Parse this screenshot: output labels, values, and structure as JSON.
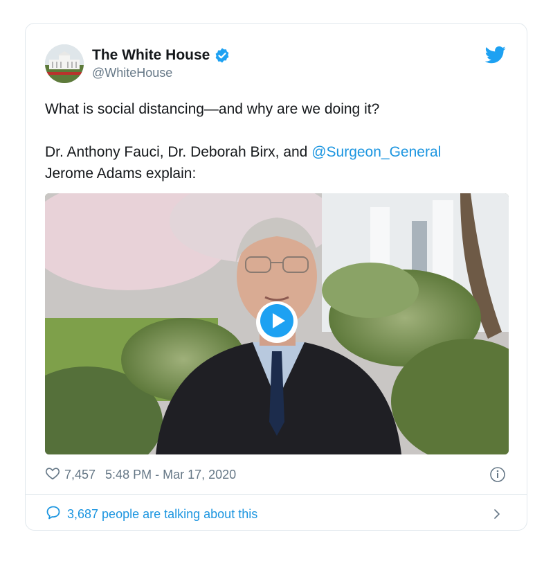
{
  "tweet": {
    "display_name": "The White House",
    "handle": "@WhiteHouse",
    "text_line1": "What is social distancing—and why are we doing it?",
    "text_line2_prefix": "Dr. Anthony Fauci, Dr. Deborah Birx, and ",
    "mention": "@Surgeon_General",
    "text_line3": "Jerome Adams explain:",
    "likes": "7,457",
    "timestamp": "5:48 PM - Mar 17, 2020",
    "talking": "3,687 people are talking about this"
  },
  "icons": {
    "verified": "verified-badge-icon",
    "brand": "twitter-bird-icon",
    "play": "play-icon",
    "like": "heart-icon",
    "info": "info-icon",
    "conversation": "speech-bubble-icon",
    "chevron": "chevron-right-icon"
  },
  "colors": {
    "accent": "#1b95e0",
    "text": "#14171a",
    "muted": "#657786",
    "border": "#e1e8ed"
  }
}
